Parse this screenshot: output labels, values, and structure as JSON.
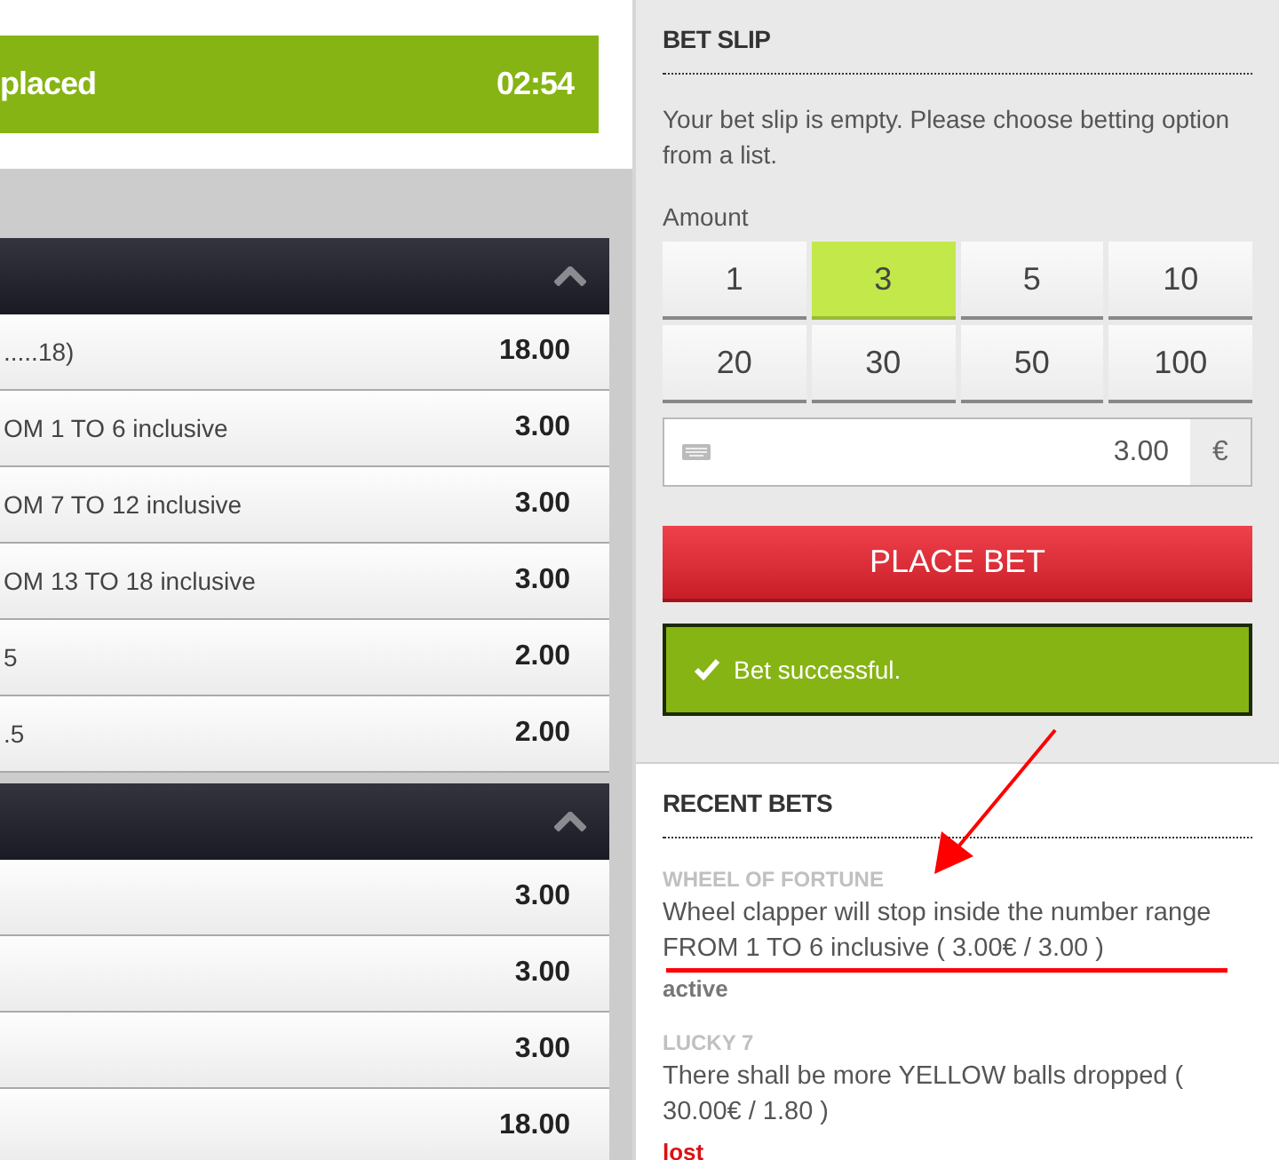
{
  "banner": {
    "title": "placed",
    "timer": "02:54"
  },
  "market_groups": [
    {
      "expanded": true,
      "rows": [
        {
          "label": ".....18)",
          "odds": "18.00"
        },
        {
          "label": "OM 1 TO 6 inclusive",
          "odds": "3.00"
        },
        {
          "label": "OM 7 TO 12 inclusive",
          "odds": "3.00"
        },
        {
          "label": "OM 13 TO 18 inclusive",
          "odds": "3.00"
        },
        {
          "label": "5",
          "odds": "2.00"
        },
        {
          "label": ".5",
          "odds": "2.00"
        }
      ]
    },
    {
      "expanded": true,
      "rows": [
        {
          "label": "",
          "odds": "3.00"
        },
        {
          "label": "",
          "odds": "3.00"
        },
        {
          "label": "",
          "odds": "3.00"
        },
        {
          "label": "",
          "odds": "18.00"
        }
      ]
    }
  ],
  "bet_slip": {
    "title": "BET SLIP",
    "message": "Your bet slip is empty. Please choose betting option from a list.",
    "amount_label": "Amount",
    "amounts": [
      {
        "label": "1",
        "selected": false
      },
      {
        "label": "3",
        "selected": true
      },
      {
        "label": "5",
        "selected": false
      },
      {
        "label": "10",
        "selected": false
      },
      {
        "label": "20",
        "selected": false
      },
      {
        "label": "30",
        "selected": false
      },
      {
        "label": "50",
        "selected": false
      },
      {
        "label": "100",
        "selected": false
      }
    ],
    "amount_field": {
      "value": "3.00",
      "currency": "€"
    },
    "place_bet": "PLACE BET",
    "notice": "Bet successful."
  },
  "recent_bets": {
    "title": "RECENT BETS",
    "bets": [
      {
        "game": "WHEEL OF FORTUNE",
        "description": "Wheel clapper will stop inside the number range FROM 1 TO 6 inclusive ( 3.00€ / 3.00 )",
        "status": "active",
        "kind": "active"
      },
      {
        "game": "LUCKY 7",
        "description": "There shall be more YELLOW balls dropped ( 30.00€ / 1.80 )",
        "status": "lost",
        "kind": "lost"
      }
    ]
  }
}
